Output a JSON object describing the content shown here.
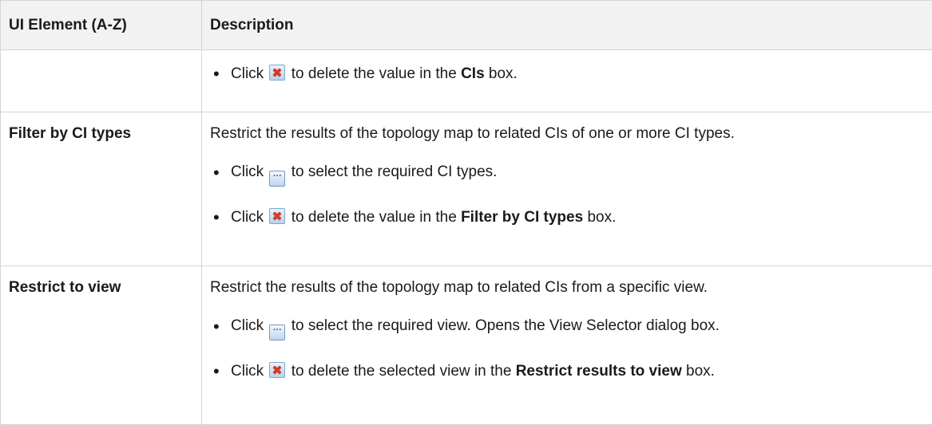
{
  "table": {
    "headers": {
      "element": "UI Element (A-Z)",
      "description": "Description"
    },
    "rows": [
      {
        "element": "",
        "description": "",
        "bullets": [
          {
            "pre": "Click",
            "icon": "delete-icon",
            "post": "to delete the value in the",
            "bold": "CIs",
            "tail": "box."
          }
        ]
      },
      {
        "element": "Filter by CI types",
        "description": "Restrict the results of the topology map to related CIs of one or more CI types.",
        "bullets": [
          {
            "pre": "Click",
            "icon": "browse-icon",
            "post": "to select the required CI types.",
            "bold": "",
            "tail": ""
          },
          {
            "pre": "Click",
            "icon": "delete-icon",
            "post": "to delete the value in the",
            "bold": "Filter by CI types",
            "tail": "box."
          }
        ]
      },
      {
        "element": "Restrict to view",
        "description": "Restrict the results of the topology map to related CIs from a specific view.",
        "bullets": [
          {
            "pre": "Click",
            "icon": "browse-icon",
            "post": "to select the required view. Opens the View Selector dialog box.",
            "bold": "",
            "tail": ""
          },
          {
            "pre": "Click",
            "icon": "delete-icon",
            "post": "to delete the selected view in the",
            "bold": "Restrict results to view",
            "tail": "box."
          }
        ]
      }
    ]
  },
  "icons": {
    "delete": "delete-icon",
    "browse": "browse-icon",
    "browse_glyph": "···"
  }
}
